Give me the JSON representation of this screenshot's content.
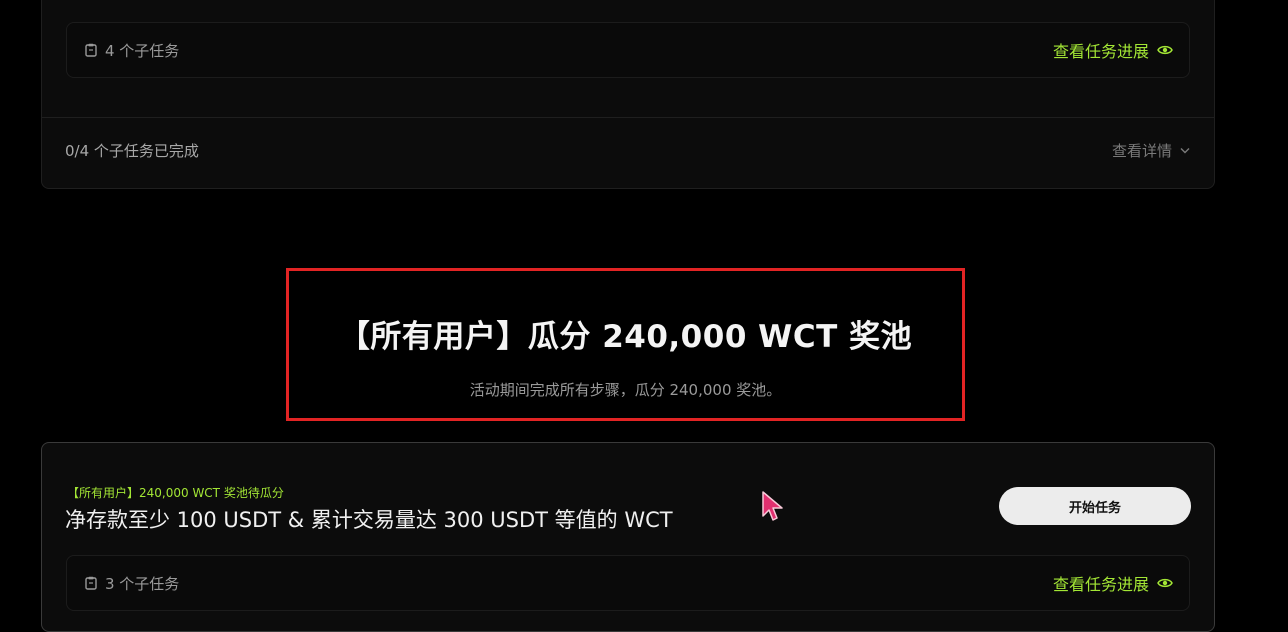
{
  "top_card": {
    "subtask_count": "4 个子任务",
    "progress_link": "查看任务进展",
    "completed": "0/4 个子任务已完成",
    "details_link": "查看详情"
  },
  "section": {
    "title": "【所有用户】瓜分 240,000 WCT 奖池",
    "subtitle": "活动期间完成所有步骤，瓜分 240,000 奖池。"
  },
  "bottom_card": {
    "pool_tag": "【所有用户】240,000 WCT 奖池待瓜分",
    "task_title": "净存款至少 100 USDT & 累计交易量达 300 USDT 等值的 WCT",
    "start_button": "开始任务",
    "subtask_count": "3 个子任务",
    "progress_link": "查看任务进展"
  },
  "icons": {
    "clipboard": "clipboard-icon",
    "eye": "eye-icon",
    "chevron": "chevron-down-icon",
    "cursor": "mouse-cursor-icon"
  },
  "colors": {
    "accent": "#a3e635",
    "highlight": "#e22424",
    "cursor": "#e0306f"
  }
}
